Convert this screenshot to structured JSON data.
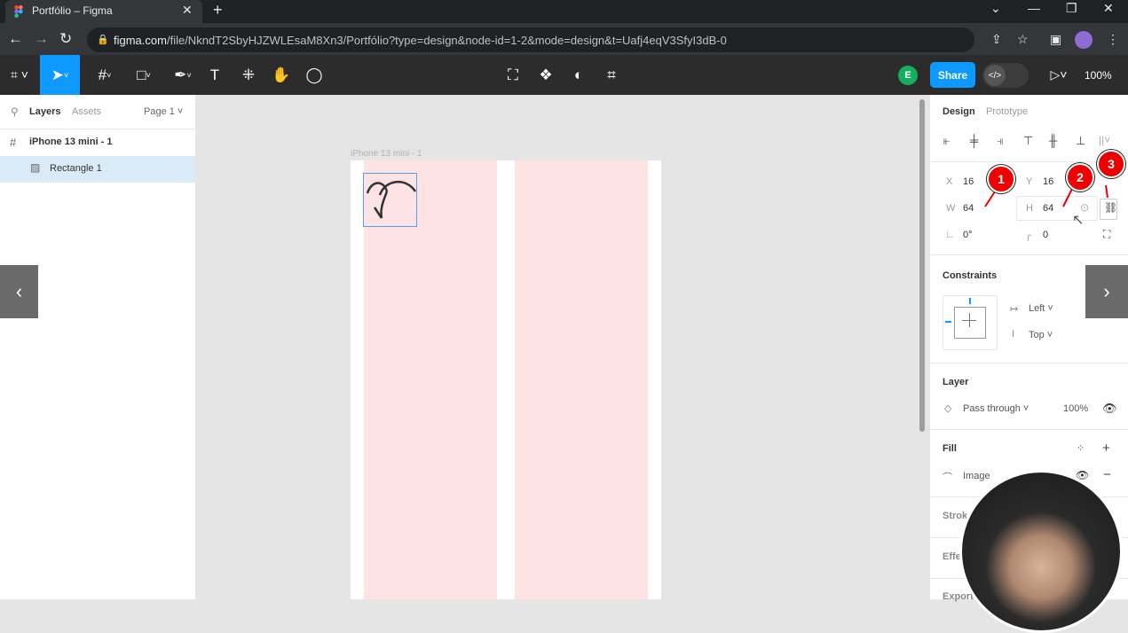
{
  "browser": {
    "tab_title": "Portfólio – Figma",
    "tab_close": "✕",
    "new_tab": "+",
    "url_domain": "figma.com",
    "url_path": "/file/NkndT2SbyHJZWLEsaM8Xn3/Portfólio?type=design&node-id=1-2&mode=design&t=Uafj4eqV3SfyI3dB-0"
  },
  "toolbar": {
    "share_label": "Share",
    "avatar_initial": "E",
    "zoom": "100%"
  },
  "left_panel": {
    "tabs": [
      "Layers",
      "Assets"
    ],
    "page": "Page 1",
    "layers": [
      {
        "name": "iPhone 13 mini - 1",
        "icon": "frame-icon"
      },
      {
        "name": "Rectangle 1",
        "icon": "image-icon"
      }
    ]
  },
  "canvas": {
    "frame_label": "iPhone 13 mini - 1"
  },
  "right_panel": {
    "tabs": [
      "Design",
      "Prototype"
    ],
    "x_label": "X",
    "x": "16",
    "y_label": "Y",
    "y": "16",
    "w_label": "W",
    "w": "64",
    "h_label": "H",
    "h": "64",
    "rotation": "0°",
    "radius": "0",
    "constraints_title": "Constraints",
    "constraint_h": "Left",
    "constraint_v": "Top",
    "layer_title": "Layer",
    "blend": "Pass through",
    "opacity": "100%",
    "fill_title": "Fill",
    "fill_type": "Image",
    "stroke_title": "Strok",
    "effects_title": "Effe",
    "export_title": "Export"
  },
  "annotations": [
    "1",
    "2",
    "3"
  ],
  "nav": {
    "prev": "‹",
    "next": "›"
  },
  "colors": {
    "accent": "#0d99ff",
    "annotation": "#ee0000",
    "frame_fill": "#fde3e3"
  }
}
